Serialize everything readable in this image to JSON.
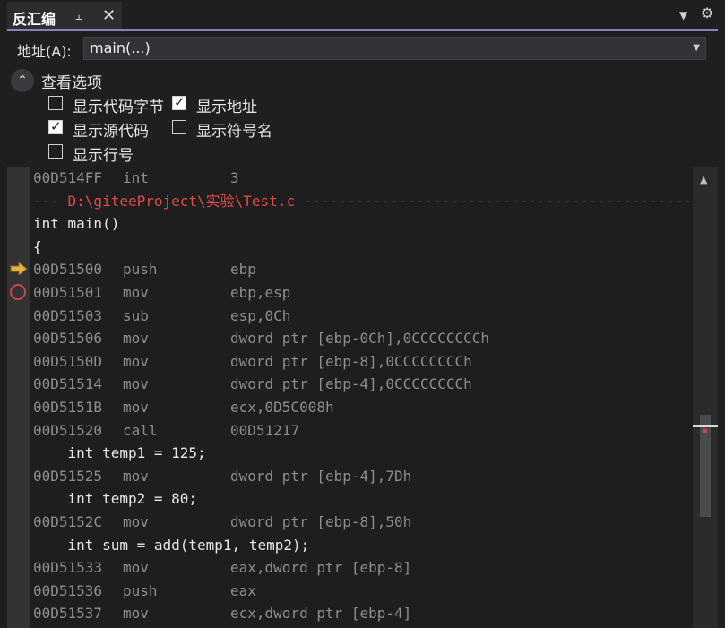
{
  "tab": {
    "title": "反汇编",
    "pin_icon": "pin-icon",
    "close_icon": "close-icon"
  },
  "toolbar": {
    "dropdown_icon": "chevron-down-icon",
    "settings_icon": "gear-icon"
  },
  "address": {
    "label": "地址(A):",
    "value": "main(...)"
  },
  "view_options": {
    "title": "查看选项",
    "expanded": true,
    "options": [
      {
        "label": "显示代码字节",
        "checked": false
      },
      {
        "label": "显示地址",
        "checked": true
      },
      {
        "label": "显示源代码",
        "checked": true
      },
      {
        "label": "显示符号名",
        "checked": false
      },
      {
        "label": "显示行号",
        "checked": false
      }
    ]
  },
  "colors": {
    "accent": "#8e7cc3",
    "separator": "#e04a4a",
    "breakpoint": "#c94848",
    "current_instruction_arrow": "#e2b33f"
  },
  "disassembly": {
    "lines": [
      {
        "kind": "asm",
        "addr": "00D514FF",
        "op": "int",
        "arg": "3"
      },
      {
        "kind": "sep",
        "text": "--- D:\\giteeProject\\实验\\Test.c -----------------------------------------------"
      },
      {
        "kind": "src",
        "text": "int main()"
      },
      {
        "kind": "src",
        "text": "{"
      },
      {
        "kind": "asm",
        "addr": "00D51500",
        "op": "push",
        "arg": "ebp"
      },
      {
        "kind": "asm",
        "addr": "00D51501",
        "op": "mov",
        "arg": "ebp,esp"
      },
      {
        "kind": "asm",
        "addr": "00D51503",
        "op": "sub",
        "arg": "esp,0Ch"
      },
      {
        "kind": "asm",
        "addr": "00D51506",
        "op": "mov",
        "arg": "dword ptr [ebp-0Ch],0CCCCCCCCh"
      },
      {
        "kind": "asm",
        "addr": "00D5150D",
        "op": "mov",
        "arg": "dword ptr [ebp-8],0CCCCCCCCh"
      },
      {
        "kind": "asm",
        "addr": "00D51514",
        "op": "mov",
        "arg": "dword ptr [ebp-4],0CCCCCCCCh"
      },
      {
        "kind": "asm",
        "addr": "00D5151B",
        "op": "mov",
        "arg": "ecx,0D5C008h"
      },
      {
        "kind": "asm",
        "addr": "00D51520",
        "op": "call",
        "arg": "00D51217"
      },
      {
        "kind": "src",
        "text": "    int temp1 = 125;"
      },
      {
        "kind": "asm",
        "addr": "00D51525",
        "op": "mov",
        "arg": "dword ptr [ebp-4],7Dh"
      },
      {
        "kind": "src",
        "text": "    int temp2 = 80;"
      },
      {
        "kind": "asm",
        "addr": "00D5152C",
        "op": "mov",
        "arg": "dword ptr [ebp-8],50h"
      },
      {
        "kind": "src",
        "text": "    int sum = add(temp1, temp2);"
      },
      {
        "kind": "asm",
        "addr": "00D51533",
        "op": "mov",
        "arg": "eax,dword ptr [ebp-8]"
      },
      {
        "kind": "asm",
        "addr": "00D51536",
        "op": "push",
        "arg": "eax"
      },
      {
        "kind": "asm",
        "addr": "00D51537",
        "op": "mov",
        "arg": "ecx,dword ptr [ebp-4]"
      }
    ],
    "current_instruction_addr": "00D51500",
    "breakpoint_addr": "00D51501"
  },
  "scrollbar": {
    "up_icon": "scroll-up-arrow-icon"
  }
}
